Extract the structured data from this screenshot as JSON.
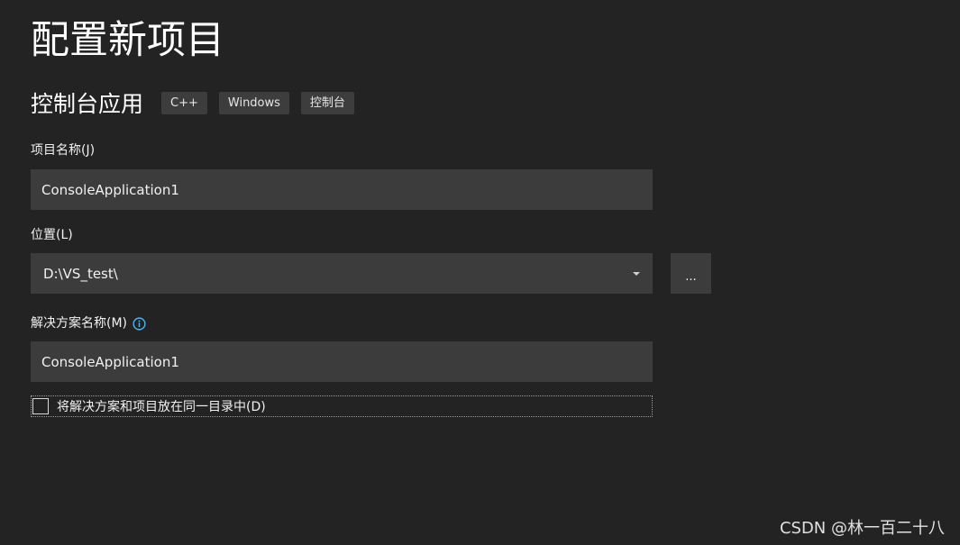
{
  "header": {
    "title": "配置新项目"
  },
  "template": {
    "name": "控制台应用",
    "tags": [
      "C++",
      "Windows",
      "控制台"
    ]
  },
  "project_name": {
    "label": "项目名称(J)",
    "value": "ConsoleApplication1"
  },
  "location": {
    "label": "位置(L)",
    "value": "D:\\VS_test\\",
    "browse_label": "..."
  },
  "solution_name": {
    "label": "解决方案名称(M)",
    "value": "ConsoleApplication1",
    "info_icon": "info-icon"
  },
  "same_directory": {
    "label": "将解决方案和项目放在同一目录中(D)",
    "checked": false
  },
  "watermark": "CSDN @林一百二十八",
  "colors": {
    "background": "#232323",
    "input_background": "#3c3c3c",
    "tag_background": "#3d3d3d",
    "info_accent": "#4fb3f0"
  }
}
